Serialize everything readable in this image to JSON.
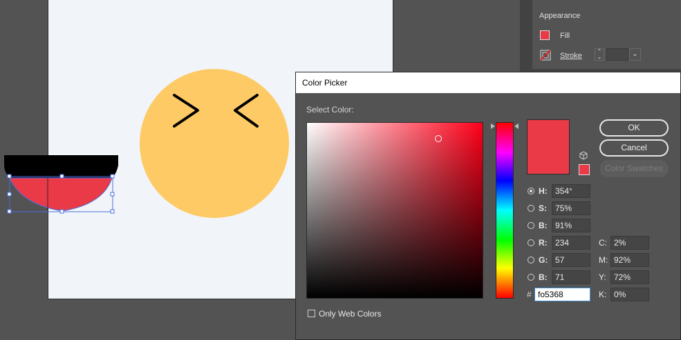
{
  "colors": {
    "workspace": "#535353",
    "artboard": "#f1f4f8",
    "face": "#fdca65",
    "mouth_top": "#000000",
    "mouth": "#ea3947",
    "selection": "#4a6fe0",
    "eyes": "#000000"
  },
  "appearance_panel": {
    "title": "Appearance",
    "fill_label": "Fill",
    "stroke_label": "Stroke",
    "fill_color": "#ea3947"
  },
  "dialog": {
    "title": "Color Picker",
    "select_color_label": "Select Color:",
    "current_color": "#ea3947",
    "ok_label": "OK",
    "cancel_label": "Cancel",
    "swatches_label": "Color Swatches",
    "hsb_rgb": [
      {
        "label": "H:",
        "value": "354°",
        "selected": true
      },
      {
        "label": "S:",
        "value": "75%",
        "selected": false
      },
      {
        "label": "B:",
        "value": "91%",
        "selected": false
      },
      {
        "label": "R:",
        "value": "234",
        "selected": false
      },
      {
        "label": "G:",
        "value": "57",
        "selected": false
      },
      {
        "label": "B:",
        "value": "71",
        "selected": false
      }
    ],
    "cmyk": [
      {
        "label": "C:",
        "value": "2%"
      },
      {
        "label": "M:",
        "value": "92%"
      },
      {
        "label": "Y:",
        "value": "72%"
      },
      {
        "label": "K:",
        "value": "0%"
      }
    ],
    "hex_prefix": "#",
    "hex_value": "fo5368",
    "web_colors_label": "Only Web Colors"
  }
}
